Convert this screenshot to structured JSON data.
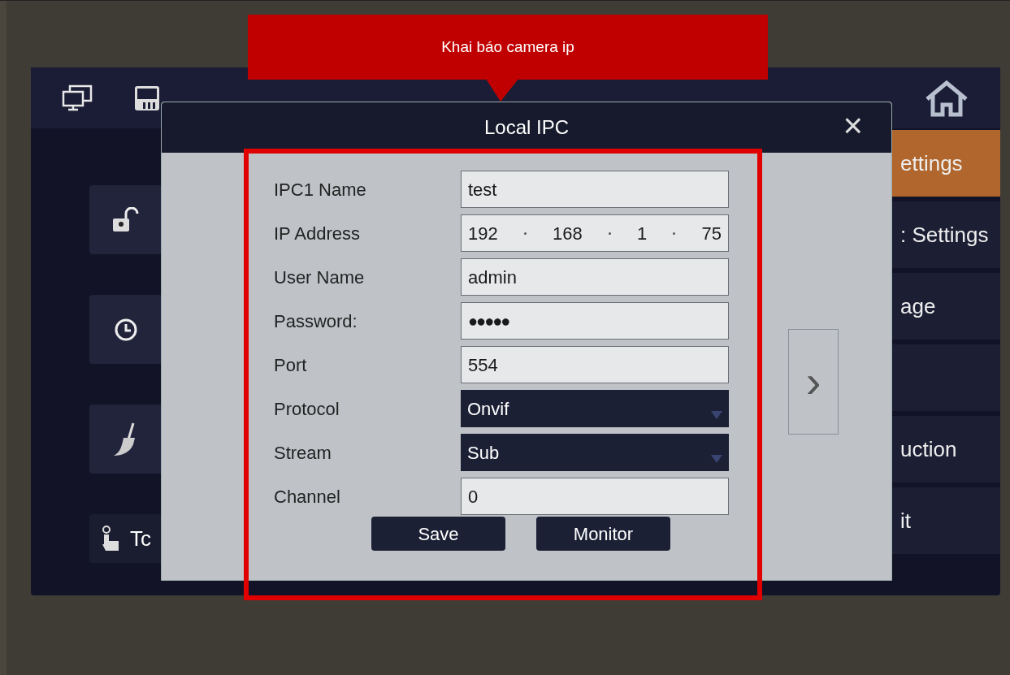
{
  "annotation": {
    "callout": "Khai báo camera ip"
  },
  "screen": {
    "right_menu": [
      {
        "label": "ettings",
        "selected": true
      },
      {
        "label": ": Settings",
        "selected": false
      },
      {
        "label": "age",
        "selected": false
      },
      {
        "selected": false
      },
      {
        "label": "uction",
        "selected": false
      },
      {
        "label": "it",
        "selected": false
      }
    ],
    "touch_label": "Tc"
  },
  "dialog": {
    "title": "Local IPC",
    "close": "×",
    "next": "›",
    "fields": [
      {
        "label": "IPC1 Name",
        "kind": "text",
        "value": "test"
      },
      {
        "label": "IP Address",
        "kind": "ip",
        "parts": [
          "192",
          "168",
          "1",
          "75"
        ]
      },
      {
        "label": "User Name",
        "kind": "text",
        "value": "admin"
      },
      {
        "label": "Password:",
        "kind": "password",
        "value": "●●●●●"
      },
      {
        "label": "Port",
        "kind": "text",
        "value": "554"
      },
      {
        "label": "Protocol",
        "kind": "select",
        "value": "Onvif"
      },
      {
        "label": "Stream",
        "kind": "select",
        "value": "Sub"
      },
      {
        "label": "Channel",
        "kind": "text",
        "value": "0"
      }
    ],
    "buttons": [
      "Save",
      "Monitor"
    ]
  }
}
